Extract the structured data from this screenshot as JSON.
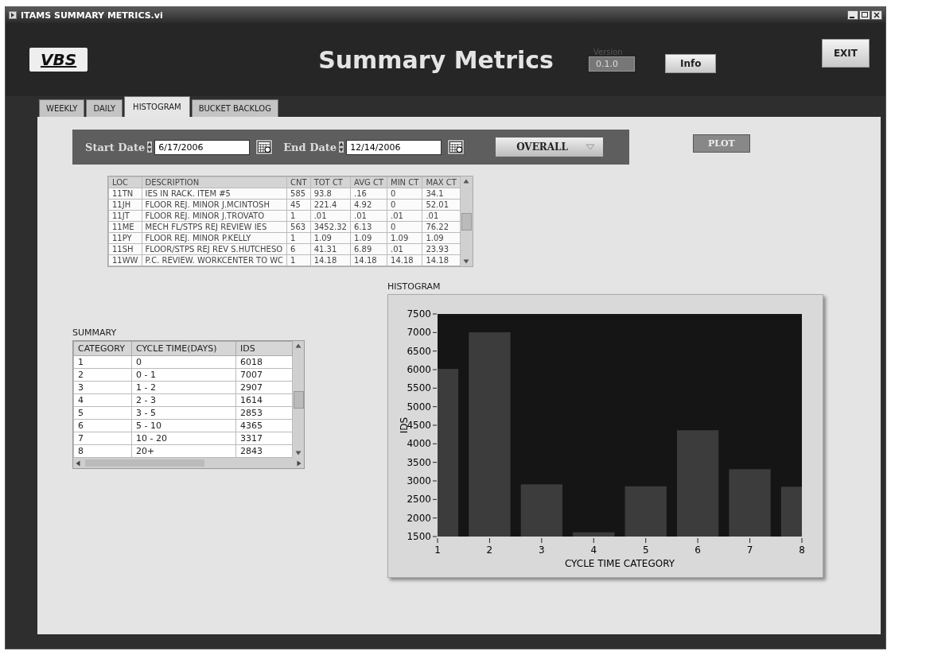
{
  "window": {
    "title": "ITAMS SUMMARY METRICS.vi"
  },
  "header": {
    "logo": "VBS",
    "title": "Summary Metrics",
    "version_label": "Version",
    "version": "0.1.0",
    "info_button": "Info",
    "exit_button": "EXIT"
  },
  "tabs": [
    {
      "label": "WEEKLY",
      "selected": false
    },
    {
      "label": "DAILY",
      "selected": false
    },
    {
      "label": "HISTOGRAM",
      "selected": true
    },
    {
      "label": "BUCKET BACKLOG",
      "selected": false
    }
  ],
  "filters": {
    "start_label": "Start Date",
    "start_value": "6/17/2006",
    "end_label": "End Date",
    "end_value": "12/14/2006",
    "mode": "OVERALL",
    "plot_button": "PLOT"
  },
  "details_table": {
    "columns": [
      "LOC",
      "DESCRIPTION",
      "CNT",
      "TOT CT",
      "AVG CT",
      "MIN CT",
      "MAX CT"
    ],
    "rows": [
      [
        "11TN",
        "IES IN RACK. ITEM #5",
        "585",
        "93.8",
        ".16",
        "0",
        "34.1"
      ],
      [
        "11JH",
        "FLOOR REJ. MINOR J.MCINTOSH",
        "45",
        "221.4",
        "4.92",
        "0",
        "52.01"
      ],
      [
        "11JT",
        "FLOOR REJ. MINOR J.TROVATO",
        "1",
        ".01",
        ".01",
        ".01",
        ".01"
      ],
      [
        "11ME",
        "MECH FL/STPS REJ REVIEW IES",
        "563",
        "3452.32",
        "6.13",
        "0",
        "76.22"
      ],
      [
        "11PY",
        "FLOOR REJ. MINOR P.KELLY",
        "1",
        "1.09",
        "1.09",
        "1.09",
        "1.09"
      ],
      [
        "11SH",
        "FLOOR/STPS REJ REV S.HUTCHESO",
        "6",
        "41.31",
        "6.89",
        ".01",
        "23.93"
      ],
      [
        "11WW",
        "P.C. REVIEW. WORKCENTER TO WC",
        "1",
        "14.18",
        "14.18",
        "14.18",
        "14.18"
      ]
    ]
  },
  "summary": {
    "title": "SUMMARY",
    "columns": [
      "CATEGORY",
      "CYCLE TIME(DAYS)",
      "IDS"
    ],
    "rows": [
      [
        "1",
        "0",
        "6018"
      ],
      [
        "2",
        "0 - 1",
        "7007"
      ],
      [
        "3",
        "1 - 2",
        "2907"
      ],
      [
        "4",
        "2 - 3",
        "1614"
      ],
      [
        "5",
        "3 - 5",
        "2853"
      ],
      [
        "6",
        "5 - 10",
        "4365"
      ],
      [
        "7",
        "10 - 20",
        "3317"
      ],
      [
        "8",
        "20+",
        "2843"
      ]
    ]
  },
  "histogram": {
    "title": "HISTOGRAM",
    "chart_data": {
      "type": "bar",
      "xlabel": "CYCLE TIME CATEGORY",
      "ylabel": "IDS",
      "x": [
        1,
        2,
        3,
        4,
        5,
        6,
        7,
        8
      ],
      "series": [
        {
          "color": "#3c3c3c",
          "values": [
            6018,
            7007,
            2907,
            1614,
            2853,
            4365,
            3317,
            2843
          ]
        }
      ],
      "xlim": [
        1,
        8
      ],
      "ylim": [
        1500,
        7500
      ],
      "xticks": [
        1,
        2,
        3,
        4,
        5,
        6,
        7,
        8
      ],
      "yticks": [
        1500,
        2000,
        2500,
        3000,
        3500,
        4000,
        4500,
        5000,
        5500,
        6000,
        6500,
        7000,
        7500
      ]
    }
  }
}
